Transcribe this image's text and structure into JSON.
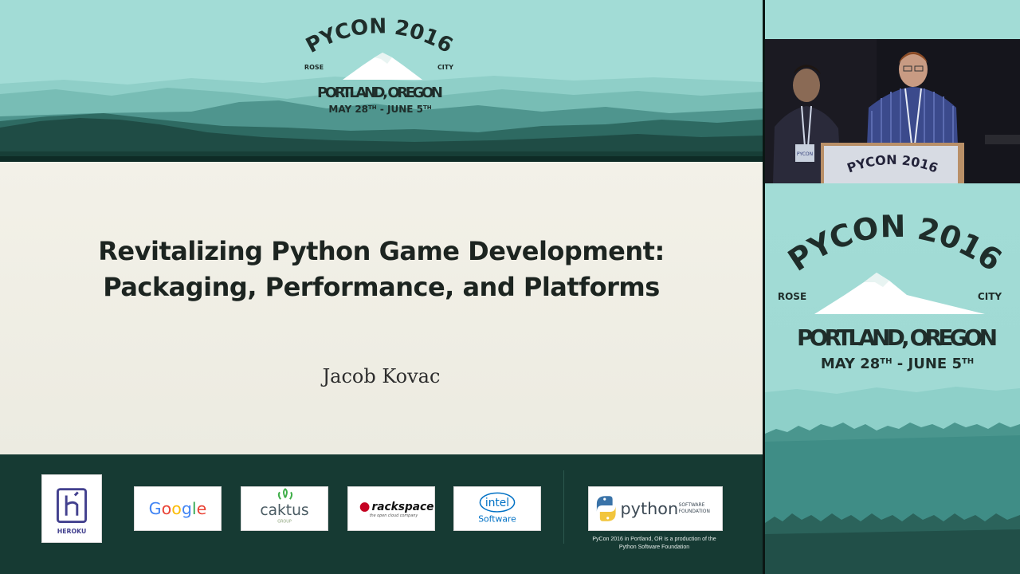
{
  "conference": {
    "name": "PYCON 2016",
    "left_tag": "ROSE",
    "right_tag": "CITY",
    "location": "PORTLAND, OREGON",
    "dates_start_day": "MAY 28",
    "dates_start_suffix": "TH",
    "dates_end_day": " - JUNE 5",
    "dates_end_suffix": "TH"
  },
  "slide": {
    "title_line1": "Revitalizing Python Game Development:",
    "title_line2": "Packaging, Performance, and Platforms",
    "speaker": "Jacob Kovac"
  },
  "sponsors": {
    "heroku": "HEROKU",
    "google": [
      "G",
      "o",
      "o",
      "g",
      "l",
      "e"
    ],
    "caktus": "caktus",
    "caktus_sub": "GROUP",
    "rackspace": "rackspace",
    "rackspace_tagline": "the open cloud company",
    "intel": "intel",
    "intel_sub": "Software",
    "python": "python",
    "python_sub1": "SOFTWARE",
    "python_sub2": "FOUNDATION",
    "psf_note_line1": "PyCon 2016 in Portland, OR is a production of the",
    "psf_note_line2": "Python Software Foundation"
  },
  "podium": {
    "sign": "PYCON 2016",
    "badge": "PYCON"
  },
  "colors": {
    "sky": "#a2dcd6",
    "dark_forest": "#163a33",
    "google_blue": "#4285f4",
    "google_red": "#ea4335",
    "google_yellow": "#fbbc05",
    "google_green": "#34a853",
    "heroku_purple": "#43418f",
    "intel_blue": "#0071c5"
  }
}
